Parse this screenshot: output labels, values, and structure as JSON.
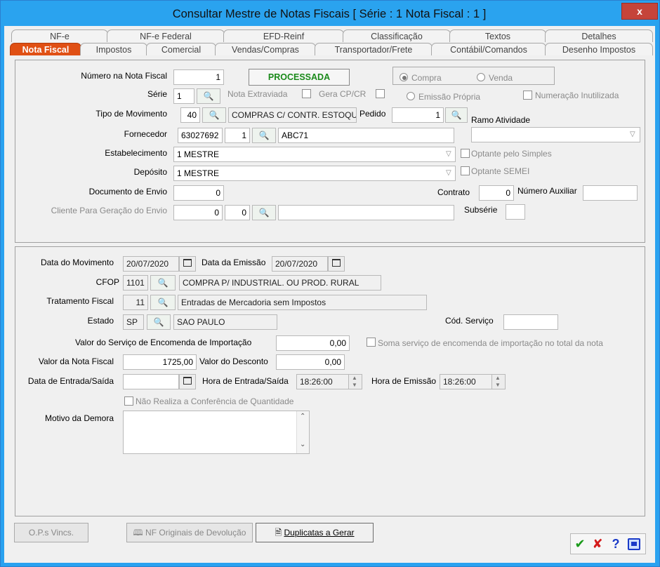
{
  "window": {
    "title": "Consultar Mestre de Notas Fiscais [ Série : 1   Nota Fiscal : 1 ]",
    "close_label": "x"
  },
  "tabs_back": [
    "NF-e",
    "NF-e Federal",
    "EFD-Reinf",
    "Classificação",
    "Textos",
    "Detalhes"
  ],
  "tabs_front": [
    "Nota Fiscal",
    "Impostos",
    "Comercial",
    "Vendas/Compras",
    "Transportador/Frete",
    "Contábil/Comandos",
    "Desenho Impostos"
  ],
  "top": {
    "numero_label": "Número na Nota Fiscal",
    "numero_value": "1",
    "status": "PROCESSADA",
    "compra_label": "Compra",
    "venda_label": "Venda",
    "serie_label": "Série",
    "serie_value": "1",
    "nota_extraviada": "Nota Extraviada",
    "gera_cpcr": "Gera CP/CR",
    "emissao_propria": "Emissão Própria",
    "numeracao_inutilizada": "Numeração Inutilizada",
    "tipo_mov_label": "Tipo de Movimento",
    "tipo_mov_code": "40",
    "tipo_mov_desc": "COMPRAS C/ CONTR. ESTOQUE",
    "pedido_label": "Pedido",
    "pedido_value": "1",
    "ramo_label": "Ramo Atividade",
    "ramo_value": "",
    "fornecedor_label": "Fornecedor",
    "fornecedor_code": "63027692",
    "fornecedor_num": "1",
    "fornecedor_name": "ABC71",
    "estab_label": "Estabelecimento",
    "estab_value": "1 MESTRE",
    "optante_simples": "Optante pelo Simples",
    "deposito_label": "Depósito",
    "deposito_value": "1 MESTRE",
    "optante_semei": "Optante SEMEI",
    "doc_envio_label": "Documento de Envio",
    "doc_envio_value": "0",
    "contrato_label": "Contrato",
    "contrato_value": "0",
    "num_aux_label": "Número Auxiliar",
    "num_aux_value": "",
    "cliente_label": "Cliente Para Geração do Envio",
    "cliente_v1": "0",
    "cliente_v2": "0",
    "cliente_name": "",
    "subserie_label": "Subsérie",
    "subserie_value": ""
  },
  "bottom": {
    "data_mov_label": "Data do Movimento",
    "data_mov_value": "20/07/2020",
    "data_emissao_label": "Data da Emissão",
    "data_emissao_value": "20/07/2020",
    "cfop_label": "CFOP",
    "cfop_code": "1101",
    "cfop_desc": "COMPRA P/ INDUSTRIAL. OU PROD. RURAL",
    "trat_label": "Tratamento Fiscal",
    "trat_code": "11",
    "trat_desc": "Entradas de Mercadoria sem Impostos",
    "estado_label": "Estado",
    "estado_code": "SP",
    "estado_desc": "SAO PAULO",
    "cod_servico_label": "Cód. Serviço",
    "cod_servico_value": "",
    "valor_serv_label": "Valor do Serviço de Encomenda de Importação",
    "valor_serv_value": "0,00",
    "soma_servico": "Soma serviço de encomenda de importação no total da nota",
    "valor_nf_label": "Valor da Nota Fiscal",
    "valor_nf_value": "1725,00",
    "valor_desc_label": "Valor do Desconto",
    "valor_desc_value": "0,00",
    "data_es_label": "Data de Entrada/Saída",
    "data_es_value": "",
    "hora_es_label": "Hora de Entrada/Saída",
    "hora_es_value": "18:26:00",
    "hora_em_label": "Hora de Emissão",
    "hora_em_value": "18:26:00",
    "nao_realiza": "Não Realiza a Conferência de Quantidade",
    "motivo_label": "Motivo da Demora",
    "motivo_value": ""
  },
  "buttons": {
    "ops": "O.P.s Vincs.",
    "nf_orig": "NF Originais de Devolução",
    "duplicatas": "Duplicatas a Gerar",
    "ok": "✔",
    "cancel": "✘",
    "help": "?"
  },
  "colors": {
    "title_bar": "#2aa3ef",
    "active_tab": "#e05014",
    "status_text": "#1a8a1a",
    "ok_icon": "#1a9a1a",
    "cancel_icon": "#d41a1a",
    "help_icon": "#1a3ac8"
  }
}
